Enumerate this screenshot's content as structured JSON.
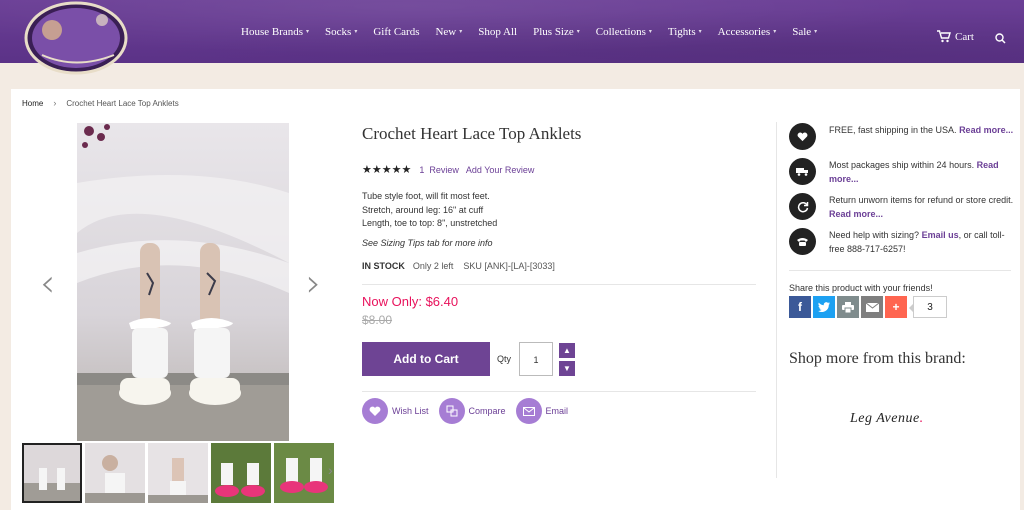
{
  "header": {
    "logo_alt": "Sock Dreams",
    "nav": [
      {
        "label": "House Brands",
        "dropdown": true
      },
      {
        "label": "Socks",
        "dropdown": true
      },
      {
        "label": "Gift Cards",
        "dropdown": false
      },
      {
        "label": "New",
        "dropdown": true
      },
      {
        "label": "Shop All",
        "dropdown": false
      },
      {
        "label": "Plus Size",
        "dropdown": true
      },
      {
        "label": "Collections",
        "dropdown": true
      },
      {
        "label": "Tights",
        "dropdown": true
      },
      {
        "label": "Accessories",
        "dropdown": true
      },
      {
        "label": "Sale",
        "dropdown": true
      }
    ],
    "cart_label": "Cart"
  },
  "breadcrumb": {
    "home": "Home",
    "current": "Crochet Heart Lace Top Anklets"
  },
  "product": {
    "title": "Crochet Heart Lace Top Anklets",
    "stars": "★★★★★",
    "review_count": "1",
    "review_label": "Review",
    "add_review": "Add Your Review",
    "description": [
      "Tube style foot, will fit most feet.",
      "Stretch, around leg: 16\" at cuff",
      "Length, toe to top: 8\", unstretched"
    ],
    "sizing_tip": "See Sizing Tips tab for more info",
    "stock_status": "IN STOCK",
    "stock_left": "Only 2 left",
    "sku": "SKU  [ANK]-[LA]-[3033]",
    "price_now": "Now Only: $6.40",
    "price_old": "$8.00",
    "add_to_cart": "Add to Cart",
    "qty_label": "Qty",
    "qty_value": "1",
    "actions": [
      {
        "label": "Wish List",
        "icon": "heart-icon"
      },
      {
        "label": "Compare",
        "icon": "compare-icon"
      },
      {
        "label": "Email",
        "icon": "envelope-icon"
      }
    ]
  },
  "sidebar": {
    "perks": [
      {
        "text": "FREE, fast shipping in the USA. ",
        "link": "Read more...",
        "icon": "heart-icon"
      },
      {
        "text": "Most packages ship within 24 hours. ",
        "link": "Read more...",
        "icon": "truck-icon"
      },
      {
        "text": "Return unworn items for refund or store credit. ",
        "link": "Read more...",
        "icon": "refresh-icon"
      },
      {
        "text": "Need help with sizing? ",
        "link": "Email us",
        "text2": ", or call toll-free 888-717-6257!",
        "icon": "phone-icon"
      }
    ],
    "share_label": "Share this product with your friends!",
    "share_count": "3",
    "shop_more": "Shop more from this brand:",
    "brand_name": "Leg Avenue"
  },
  "colors": {
    "header_purple": "#5b3287",
    "accent_purple": "#6e4494",
    "price_pink": "#e8125c",
    "facebook": "#3b5998",
    "twitter": "#1da1f2",
    "print": "#7f8c8d",
    "email": "#7f7f7f",
    "addthis": "#ff6550"
  }
}
